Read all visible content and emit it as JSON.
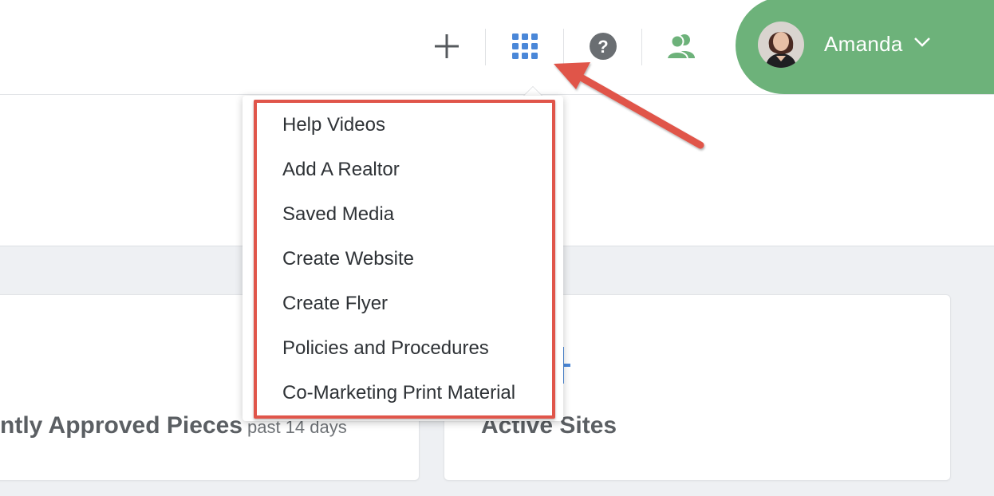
{
  "header": {
    "add_icon": "plus-icon",
    "apps_icon": "grid-icon",
    "help_icon": "help-icon",
    "team_icon": "users-icon",
    "user": {
      "name": "Amanda",
      "avatar_icon": "avatar-photo",
      "chevron_icon": "chevron-down-icon",
      "pill_color": "#6db27a"
    }
  },
  "apps_menu": {
    "items": [
      "Help Videos",
      "Add A Realtor",
      "Saved Media",
      "Create Website",
      "Create Flyer",
      "Policies and Procedures",
      "Co-Marketing Print Material"
    ]
  },
  "cards": {
    "approved": {
      "title": "ntly Approved Pieces",
      "subtitle": "past 14 days"
    },
    "active_sites": {
      "title": "Active Sites"
    }
  },
  "annotation": {
    "highlight_color": "#e0554a"
  }
}
